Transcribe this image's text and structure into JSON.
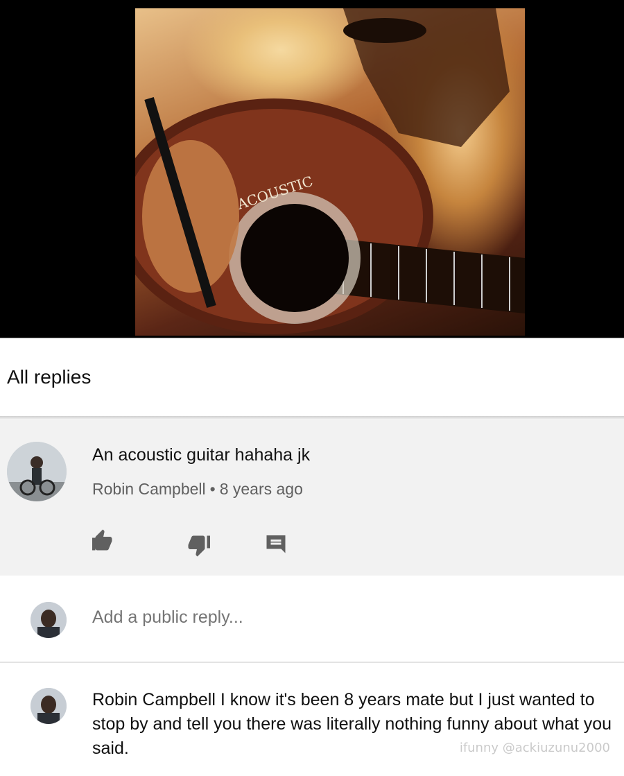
{
  "video": {
    "thumbnail_alt": "acoustic guitar album art",
    "guitar_text": "ACOUSTIC"
  },
  "replies": {
    "title": "All replies"
  },
  "comment": {
    "text": "An acoustic guitar hahaha jk",
    "author": "Robin Campbell",
    "separator": "•",
    "time": "8 years ago",
    "actions": [
      "thumbs-up-icon",
      "thumbs-down-icon",
      "reply-icon"
    ]
  },
  "add_reply": {
    "placeholder": "Add a public reply..."
  },
  "reply": {
    "text": "Robin Campbell I know it's been 8 years mate but I just wanted to stop by and tell you there was literally nothing funny about what you said."
  },
  "watermark": {
    "text": "ifunny @ackiuzunu2000"
  },
  "colors": {
    "comment_bg": "#f2f2f2",
    "meta_text": "#606060",
    "icon": "#606060"
  }
}
